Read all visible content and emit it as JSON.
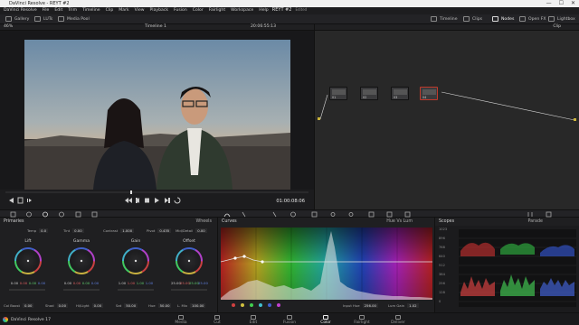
{
  "window": {
    "title": "DaVinci Resolve - REYT #2",
    "controls": [
      "—",
      "☐",
      "✕"
    ]
  },
  "menu": {
    "items": [
      "DaVinci Resolve",
      "File",
      "Edit",
      "Trim",
      "Timeline",
      "Clip",
      "Mark",
      "View",
      "Playback",
      "Fusion",
      "Color",
      "Fairlight",
      "Workspace",
      "Help"
    ],
    "project": "REYT #2",
    "status": "Edited"
  },
  "toolbar": {
    "gallery": "Gallery",
    "luts": "LUTs",
    "media_pool": "Media Pool",
    "timeline": "Timeline",
    "clips": "Clips",
    "nodes": "Nodes",
    "open_fx": "Open FX",
    "lightbox": "Lightbox"
  },
  "viewer": {
    "zoom": "46%",
    "timeline_name": "Timeline 1",
    "source_timecode": "20:06:55:13",
    "record_timecode": "01:00:08:06"
  },
  "node_editor": {
    "mode": "Clip",
    "nodes": [
      {
        "label": "01"
      },
      {
        "label": "02"
      },
      {
        "label": "03"
      },
      {
        "label": "04"
      }
    ]
  },
  "primaries": {
    "title": "Primaries",
    "mode": "Wheels",
    "temp_label": "Temp",
    "temp": "0.0",
    "tint_label": "Tint",
    "tint": "0.00",
    "contrast_label": "Contrast",
    "contrast": "1.000",
    "pivot_label": "Pivot",
    "pivot": "0.435",
    "middetail_label": "Mid/Detail",
    "middetail": "0.00",
    "wheels": [
      {
        "name": "Lift",
        "values": [
          "0.00",
          "0.00",
          "0.00",
          "0.00"
        ]
      },
      {
        "name": "Gamma",
        "values": [
          "0.00",
          "0.00",
          "0.00",
          "0.00"
        ]
      },
      {
        "name": "Gain",
        "values": [
          "1.00",
          "1.00",
          "1.00",
          "1.00"
        ]
      },
      {
        "name": "Offset",
        "values": [
          "25.00",
          "25.00",
          "25.00",
          "25.00"
        ]
      }
    ],
    "footer": {
      "colboost_label": "Col Boost",
      "colboost": "0.00",
      "shad_label": "Shad",
      "shad": "0.00",
      "hilight_label": "Hi/Light",
      "hilight": "0.00",
      "sat_label": "Sat",
      "sat": "50.00",
      "hue_label": "Hue",
      "hue": "50.00",
      "lummix_label": "L. Mix",
      "lummix": "100.00"
    }
  },
  "curves": {
    "title": "Curves",
    "mode": "Hue Vs Lum",
    "input_hue_label": "Input Hue",
    "input_hue": "256.00",
    "lum_gain_label": "Lum Gain",
    "lum_gain": "1.02"
  },
  "scopes": {
    "title": "Scopes",
    "mode": "Parade",
    "ticks": [
      "1023",
      "896",
      "768",
      "640",
      "512",
      "384",
      "256",
      "128",
      "0"
    ]
  },
  "pages": {
    "brand": "DaVinci Resolve 17",
    "items": [
      "Media",
      "Cut",
      "Edit",
      "Fusion",
      "Color",
      "Fairlight",
      "Deliver"
    ],
    "active": "Color"
  },
  "colors": {
    "accent": "#e8a431",
    "selected_node": "#c0392b",
    "curve_line": "#d8d8d8"
  }
}
